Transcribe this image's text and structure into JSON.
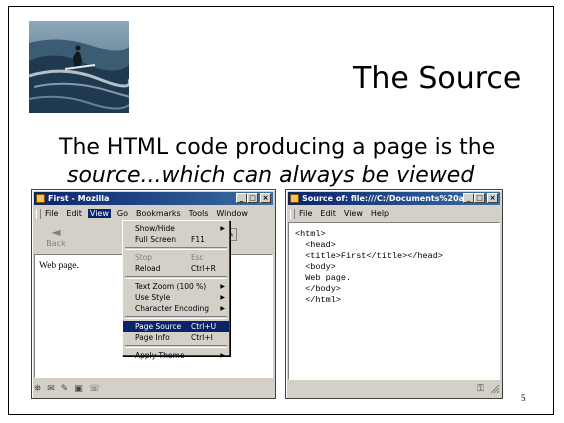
{
  "slide": {
    "title": "The Source",
    "line1": "The HTML code producing a page is the",
    "line2": "source...which can always be viewed",
    "page_number": "5"
  },
  "browser": {
    "title": "First - Mozilla",
    "menubar": [
      "File",
      "Edit",
      "View",
      "Go",
      "Bookmarks",
      "Tools",
      "Window"
    ],
    "back_label": "Back",
    "page_text": "Web page.",
    "view_menu": [
      {
        "label": "Show/Hide",
        "shortcut": "",
        "submenu": true,
        "disabled": false
      },
      {
        "label": "Full Screen",
        "shortcut": "F11",
        "submenu": false,
        "disabled": false
      },
      {
        "label": "Stop",
        "shortcut": "Esc",
        "submenu": false,
        "disabled": true
      },
      {
        "label": "Reload",
        "shortcut": "Ctrl+R",
        "submenu": false,
        "disabled": false
      },
      {
        "label": "Text Zoom (100 %)",
        "shortcut": "",
        "submenu": true,
        "disabled": false
      },
      {
        "label": "Use Style",
        "shortcut": "",
        "submenu": true,
        "disabled": false
      },
      {
        "label": "Character Encoding",
        "shortcut": "",
        "submenu": true,
        "disabled": false
      },
      {
        "label": "Page Source",
        "shortcut": "Ctrl+U",
        "submenu": false,
        "disabled": false,
        "selected": true
      },
      {
        "label": "Page Info",
        "shortcut": "Ctrl+I",
        "submenu": false,
        "disabled": false
      },
      {
        "label": "Apply Theme",
        "shortcut": "",
        "submenu": true,
        "disabled": false
      }
    ]
  },
  "source_window": {
    "title": "Source of: file:///C:/Documents%20and...",
    "menubar": [
      "File",
      "Edit",
      "View",
      "Help"
    ],
    "code": "<html>\n  <head>\n  <title>First</title></head>\n  <body>\n  Web page.\n  </body>\n  </html>"
  },
  "colors": {
    "titlebar": "#0a246a",
    "chrome": "#d4d0c8",
    "highlight": "#0a246a"
  }
}
